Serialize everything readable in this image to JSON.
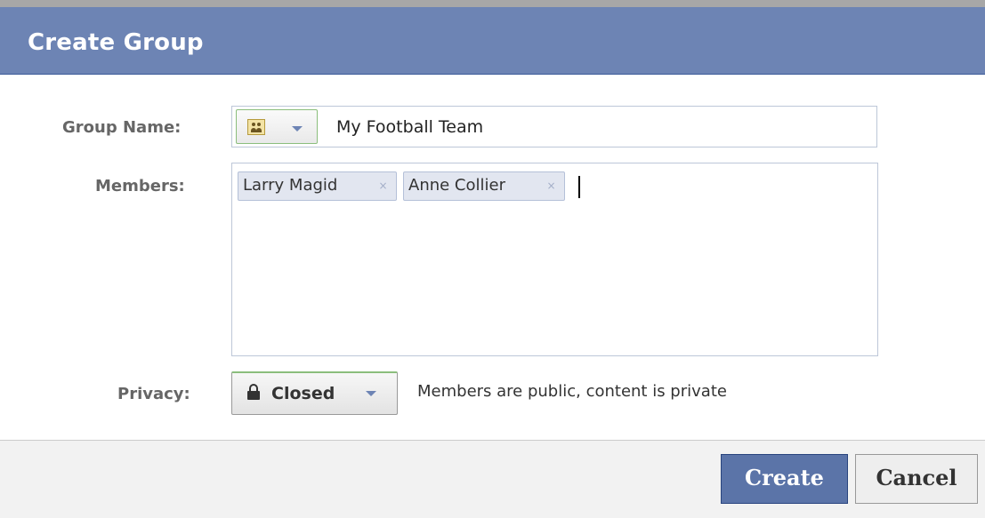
{
  "dialog": {
    "title": "Create Group"
  },
  "form": {
    "group_name": {
      "label": "Group Name:",
      "icon": "group-people-icon",
      "value": "My Football Team"
    },
    "members": {
      "label": "Members:",
      "tokens": [
        {
          "name": "Larry Magid",
          "remove": "×"
        },
        {
          "name": "Anne Collier",
          "remove": "×"
        }
      ]
    },
    "privacy": {
      "label": "Privacy:",
      "icon": "lock-icon",
      "value": "Closed",
      "description": "Members are public, content is private"
    }
  },
  "footer": {
    "create_label": "Create",
    "cancel_label": "Cancel"
  },
  "colors": {
    "title_bar": "#6d84b4",
    "primary_button": "#5b74a8",
    "token_bg": "#e2e6f0",
    "field_border": "#bdc7d8"
  }
}
